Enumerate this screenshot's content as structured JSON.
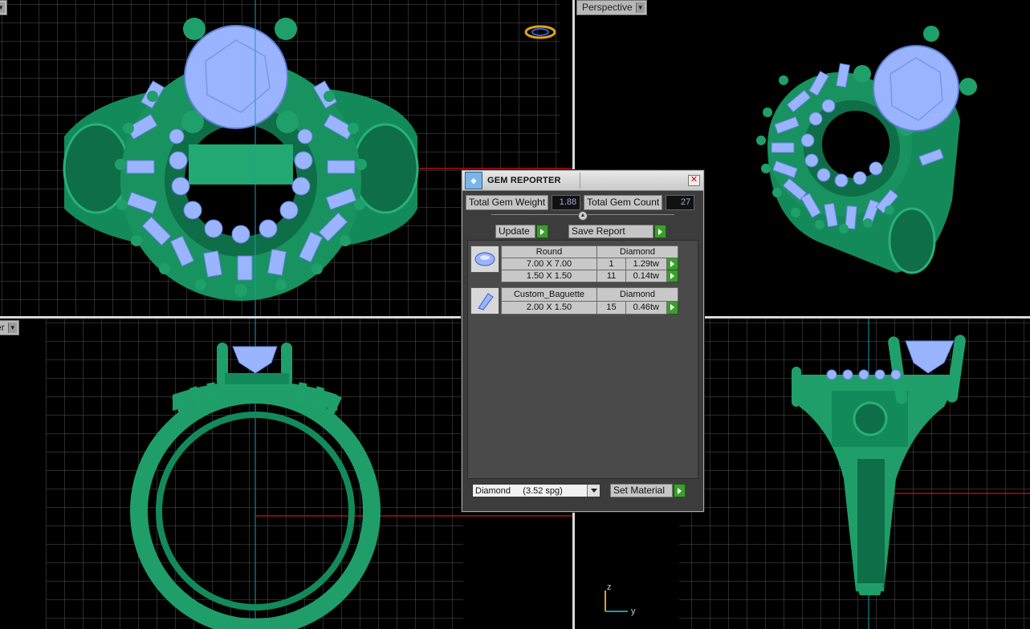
{
  "viewports": {
    "top_left": {
      "name": "top-view"
    },
    "top_right": {
      "label": "Perspective"
    },
    "bottom_left": {
      "label": "er"
    },
    "bottom_right": {
      "name": "side-view"
    }
  },
  "gem_reporter": {
    "title": "GEM REPORTER",
    "total_weight_label": "Total Gem Weight",
    "total_weight_value": "1.88",
    "total_count_label": "Total Gem Count",
    "total_count_value": "27",
    "update_label": "Update",
    "save_report_label": "Save Report",
    "groups": [
      {
        "shape": "Round",
        "material": "Diamond",
        "rows": [
          {
            "size": "7.00 X 7.00",
            "count": "1",
            "weight": "1.29tw"
          },
          {
            "size": "1.50 X 1.50",
            "count": "11",
            "weight": "0.14tw"
          }
        ]
      },
      {
        "shape": "Custom_Baguette",
        "material": "Diamond",
        "rows": [
          {
            "size": "2.00 X 1.50",
            "count": "15",
            "weight": "0.46tw"
          }
        ]
      }
    ],
    "material_select": "Diamond     (3.52 spg)",
    "set_material_label": "Set Material"
  },
  "axis": {
    "z": "z",
    "y": "y"
  },
  "colors": {
    "metal": "#1f9e6a",
    "gem": "#9ab4ff",
    "grid": "#5a5a5a",
    "axis_red": "#b01010",
    "axis_cyan": "#14a0b0"
  }
}
